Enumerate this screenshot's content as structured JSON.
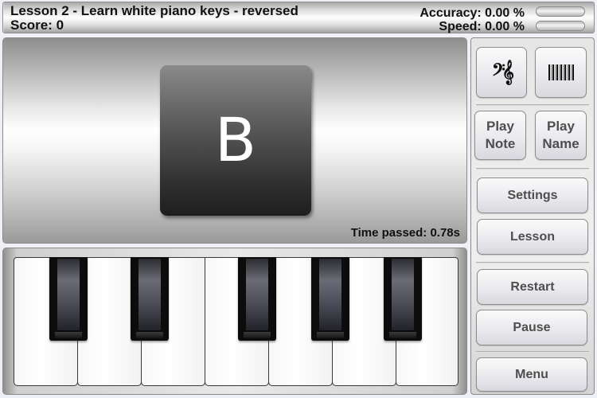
{
  "header": {
    "lesson_title": "Lesson 2 - Learn white piano keys - reversed",
    "score_label": "Score: 0",
    "accuracy_label": "Accuracy: 0.00 %",
    "speed_label": "Speed: 0.00 %",
    "accuracy_progress": 0,
    "speed_progress": 0
  },
  "display": {
    "current_note": "B",
    "time_passed": "Time passed: 0.78s"
  },
  "keyboard": {
    "white_keys": 7,
    "black_keys": 5
  },
  "side_panel": {
    "notation_mode_icon": "bass-treble-clef-icon",
    "keyboard_mode_icon": "piano-keyboard-icon",
    "play_note_line1": "Play",
    "play_note_line2": "Note",
    "play_name_line1": "Play",
    "play_name_line2": "Name",
    "settings_label": "Settings",
    "lesson_label": "Lesson",
    "restart_label": "Restart",
    "pause_label": "Pause",
    "menu_label": "Menu"
  }
}
